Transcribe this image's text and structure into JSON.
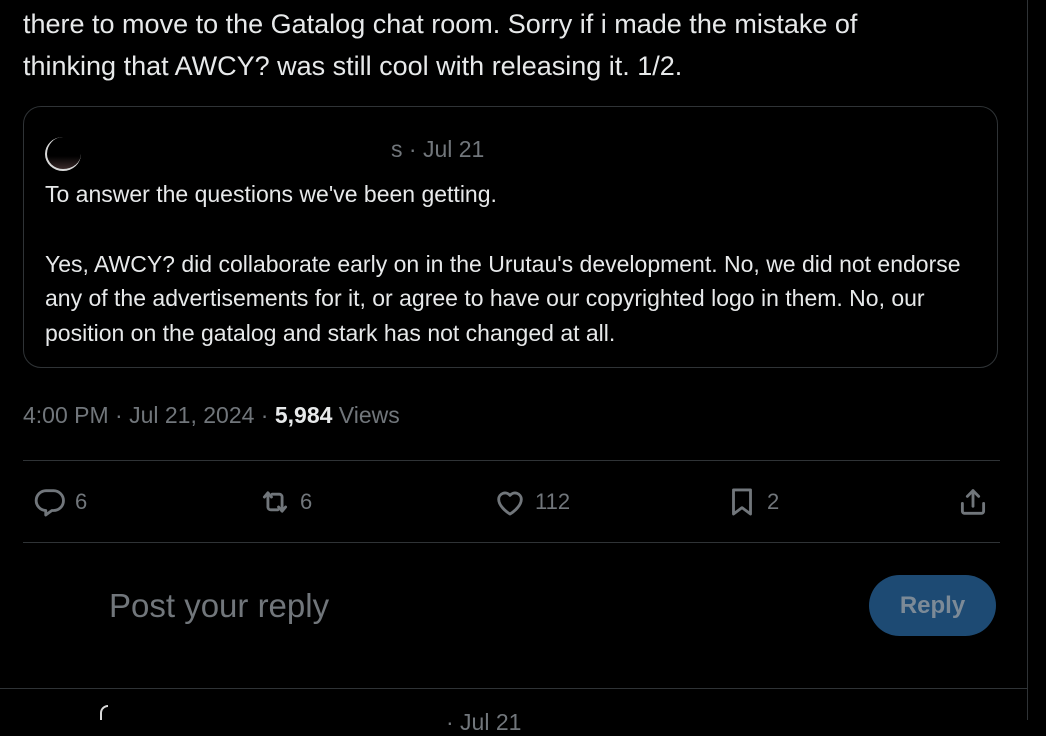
{
  "tweet": {
    "text_lines": [
      "there to move to the Gatalog chat room. Sorry if i made the mistake of",
      "thinking that AWCY? was still cool with releasing it. 1/2."
    ],
    "timestamp": "4:00 PM · Jul 21, 2024 · ",
    "views_count": "5,984",
    "views_label": " Views"
  },
  "quote": {
    "meta": "s · Jul 21",
    "line1": "To answer the questions we've been getting.",
    "paragraph2": "Yes, AWCY? did collaborate early on in the Urutau's development. No, we did not endorse any of the advertisements for it, or agree to have our copyrighted logo in them. No, our position on the gatalog and stark has not changed at all."
  },
  "actions": {
    "replies": "6",
    "reposts": "6",
    "likes": "112",
    "bookmarks": "2",
    "icons": [
      "reply-icon",
      "repost-icon",
      "like-icon",
      "bookmark-icon",
      "share-icon"
    ]
  },
  "composer": {
    "placeholder": "Post your reply",
    "button_label": "Reply"
  },
  "next_tweet": {
    "meta": "· Jul 21"
  },
  "colors": {
    "background": "#000000",
    "text": "#e7e9ea",
    "muted": "#71767b",
    "border": "#2f3336",
    "reply_button_disabled": "#1d4a73"
  }
}
